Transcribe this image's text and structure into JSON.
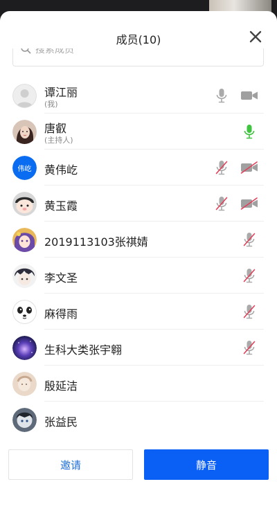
{
  "header": {
    "title": "成员(10)"
  },
  "search": {
    "placeholder": "搜索成员"
  },
  "members": [
    {
      "name": "谭江丽",
      "role": "(我)",
      "avatar": "default",
      "mic": "gray",
      "cam": "gray"
    },
    {
      "name": "唐叡",
      "role": "(主持人)",
      "avatar": "photo-girl",
      "mic": "green",
      "cam": ""
    },
    {
      "name": "黄伟屹",
      "role": "",
      "avatar": "text",
      "avatar_text": "伟屹",
      "mic": "muted",
      "cam": "off"
    },
    {
      "name": "黄玉霞",
      "role": "",
      "avatar": "cartoon-pig",
      "mic": "muted",
      "cam": "off"
    },
    {
      "name": "2019113103张祺婧",
      "role": "",
      "avatar": "anime",
      "mic": "muted",
      "cam": ""
    },
    {
      "name": "李文圣",
      "role": "",
      "avatar": "anime-dark",
      "mic": "muted",
      "cam": ""
    },
    {
      "name": "麻得雨",
      "role": "",
      "avatar": "panda-face",
      "mic": "muted",
      "cam": ""
    },
    {
      "name": "生科大类张宇翱",
      "role": "",
      "avatar": "galaxy",
      "mic": "muted",
      "cam": ""
    },
    {
      "name": "殷延洁",
      "role": "",
      "avatar": "photo-beige",
      "mic": "",
      "cam": ""
    },
    {
      "name": "张益民",
      "role": "",
      "avatar": "anime-dark2",
      "mic": "",
      "cam": ""
    }
  ],
  "footer": {
    "invite_label": "邀请",
    "mute_label": "静音"
  },
  "colors": {
    "accent": "#0a5ff5",
    "mic_green": "#3fc43f",
    "muted_red": "#e0405a",
    "icon_gray": "#9a9a9a"
  }
}
